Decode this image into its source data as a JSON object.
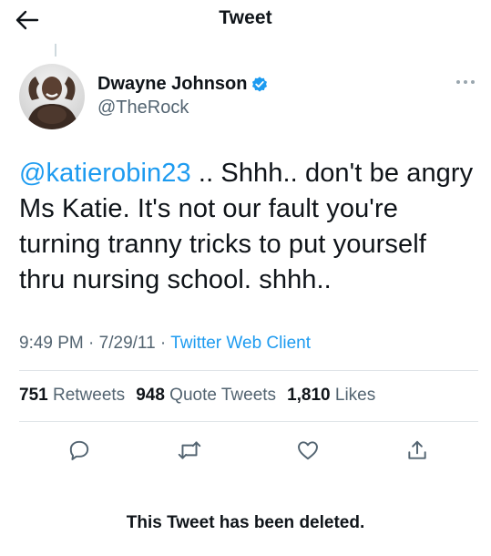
{
  "header": {
    "title": "Tweet",
    "back_icon": "arrow-left-icon"
  },
  "author": {
    "name": "Dwayne Johnson",
    "handle": "@TheRock",
    "verified": true,
    "verified_color": "#1d9bf0"
  },
  "tweet": {
    "mention": "@katierobin23",
    "text": " .. Shhh.. don't be angry Ms Katie. It's not our fault you're turning tranny tricks to put yourself thru nursing school. shhh..",
    "time": "9:49 PM",
    "date": "7/29/11",
    "client": "Twitter Web Client"
  },
  "stats": {
    "retweets_count": "751",
    "retweets_label": "Retweets",
    "quotes_count": "948",
    "quotes_label": "Quote Tweets",
    "likes_count": "1,810",
    "likes_label": "Likes"
  },
  "actions": [
    {
      "icon": "reply-icon"
    },
    {
      "icon": "retweet-icon"
    },
    {
      "icon": "like-icon"
    },
    {
      "icon": "share-icon"
    }
  ],
  "footer": {
    "deleted_note": "This Tweet has been deleted."
  },
  "colors": {
    "accent": "#1d9bf0",
    "text": "#0f1419",
    "muted": "#536471"
  }
}
